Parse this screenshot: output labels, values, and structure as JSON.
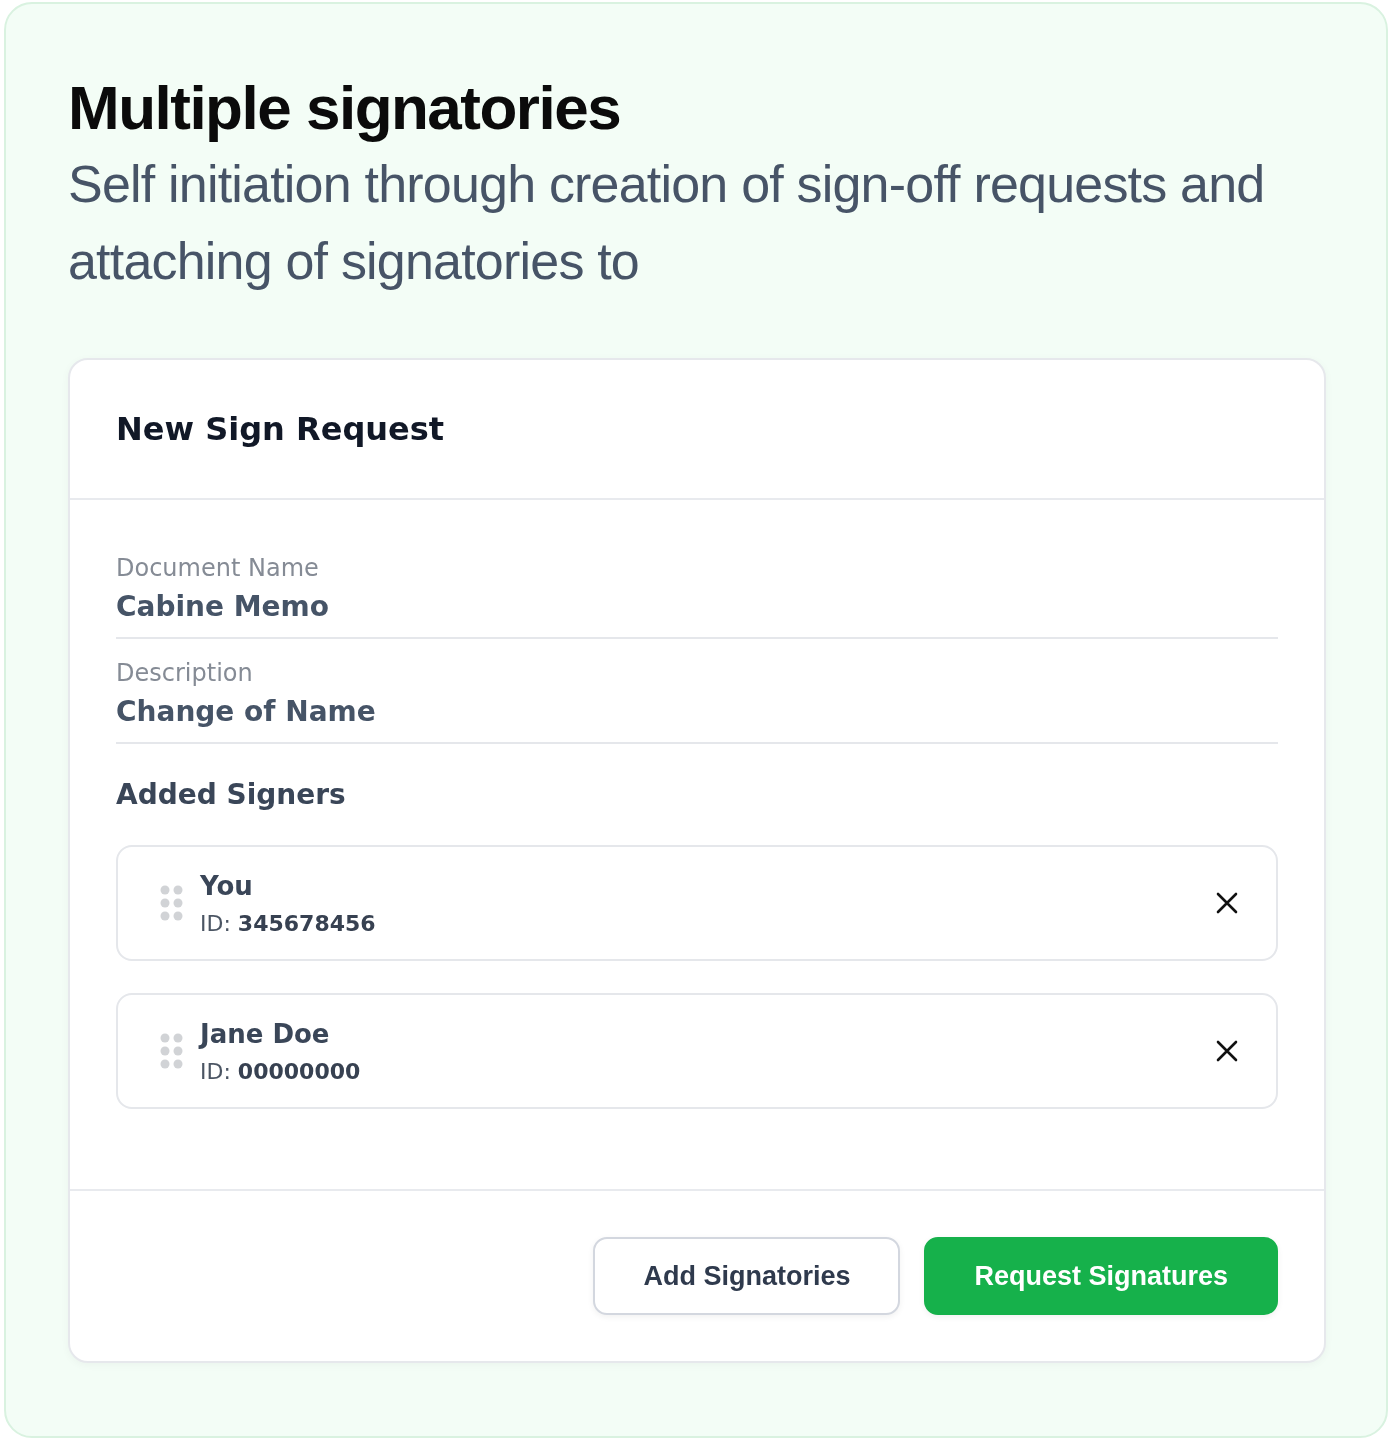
{
  "heading": {
    "title": "Multiple signatories",
    "subtitle": "Self initiation through creation of sign-off requests and attaching of signatories to"
  },
  "card": {
    "title": "New Sign Request",
    "fields": [
      {
        "label": "Document Name",
        "value": "Cabine Memo"
      },
      {
        "label": "Description",
        "value": "Change of Name"
      }
    ],
    "signers_title": "Added Signers",
    "signers": [
      {
        "name": "You",
        "id": "ID: **345678456**"
      },
      {
        "name": "Jane Doe",
        "id": "ID: **00000000**"
      }
    ],
    "buttons": [
      {
        "label": "Add Signatories",
        "kind": "secondary"
      },
      {
        "label": "Request Signatures",
        "kind": "primary"
      }
    ]
  }
}
